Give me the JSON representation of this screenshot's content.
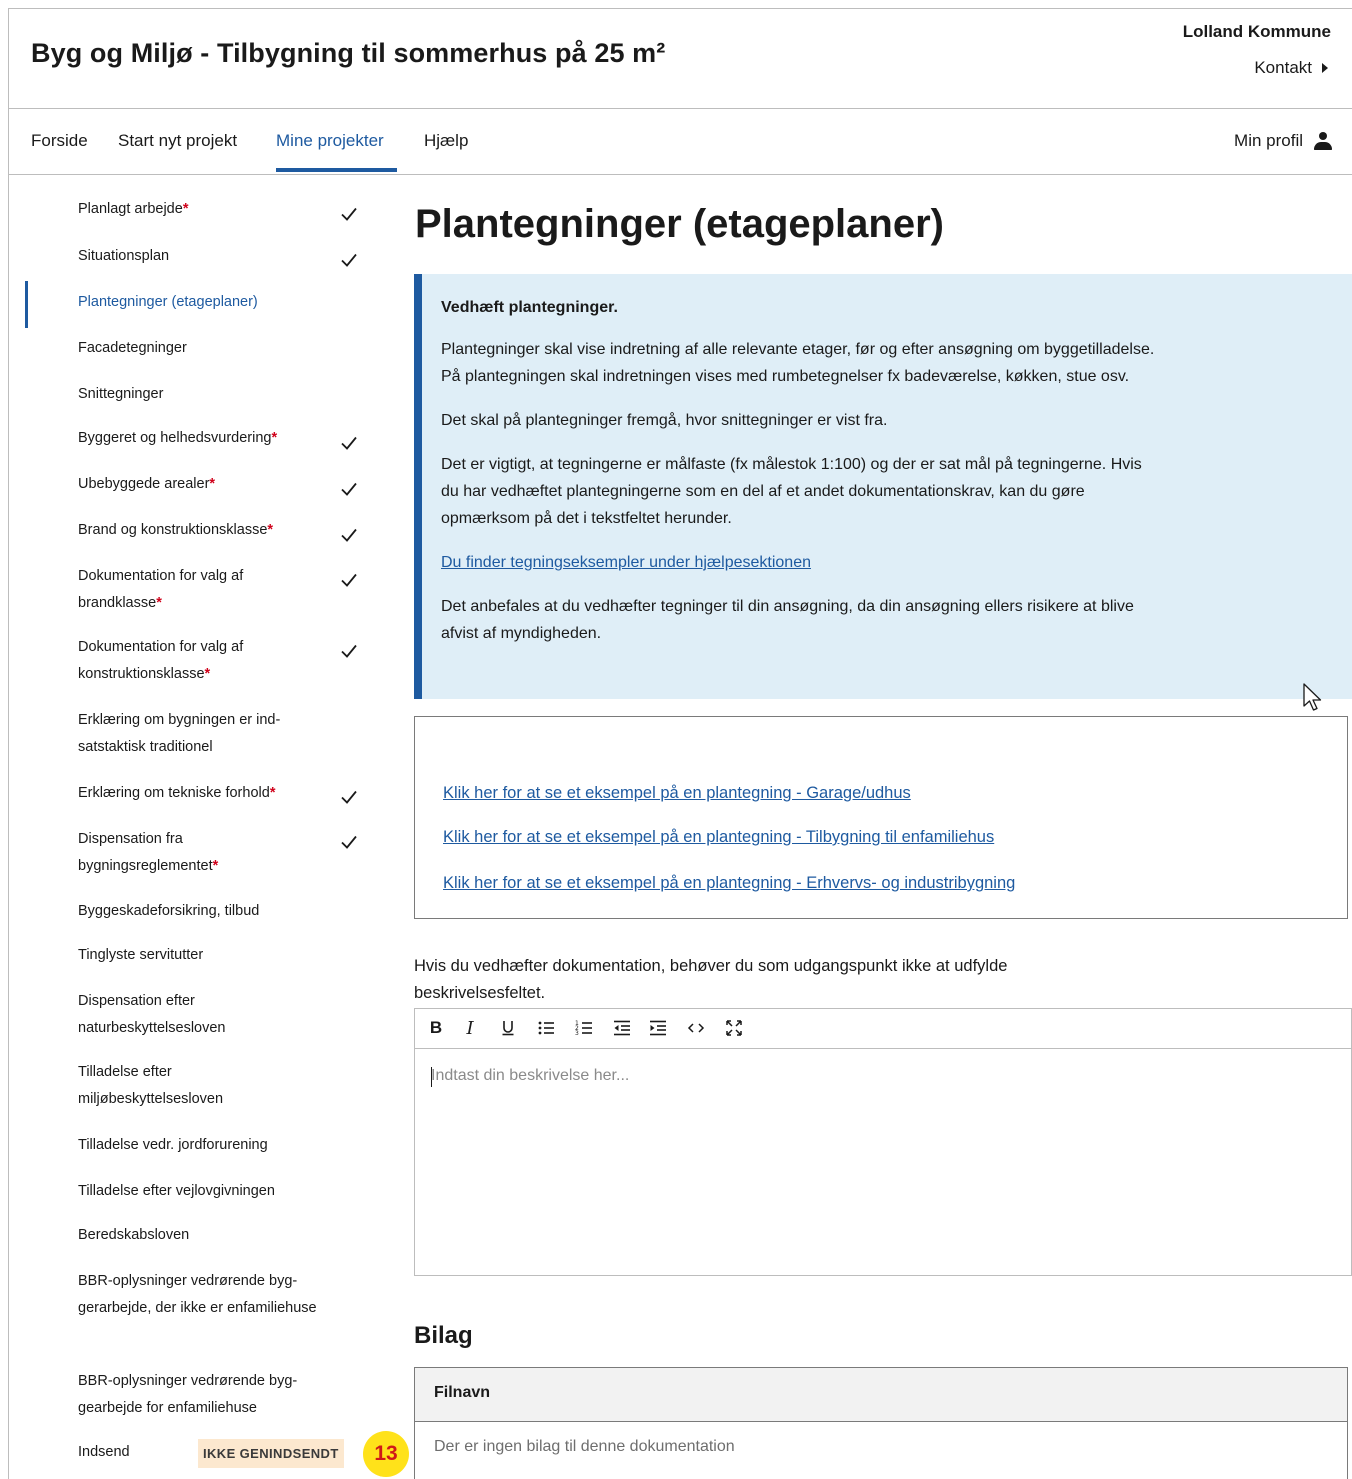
{
  "header": {
    "title": "Byg og Miljø - Tilbygning til sommerhus på 25 m²",
    "org": "Lolland Kommune",
    "contact": "Kontakt"
  },
  "nav": {
    "items": [
      "Forside",
      "Start nyt projekt",
      "Mine projekter",
      "Hjælp"
    ],
    "active": "Mine projekter",
    "profile": "Min profil"
  },
  "sidebar": {
    "items": [
      {
        "label": "Planlagt arbejde",
        "required": "*",
        "checked": true
      },
      {
        "label": "Situationsplan",
        "required": "",
        "checked": true
      },
      {
        "label": "Plantegninger (etageplaner)",
        "required": "",
        "checked": false,
        "active": true
      },
      {
        "label": "Facadetegninger",
        "required": "",
        "checked": false
      },
      {
        "label": "Snittegninger",
        "required": "",
        "checked": false
      },
      {
        "label": "Byggeret og helhedsvurdering",
        "required": "*",
        "checked": true
      },
      {
        "label": "Ubebyggede arealer",
        "required": "*",
        "checked": true
      },
      {
        "label": "Brand og konstruktionsklasse",
        "required": "*",
        "checked": true
      },
      {
        "label": "Dokumentation for valg af brandklasse",
        "required": "*",
        "checked": true
      },
      {
        "label": "Dokumentation for valg af konstruktionsklasse",
        "required": "*",
        "checked": true
      },
      {
        "label": "Erklæring om bygningen er ind-satstaktisk traditionel",
        "required": "",
        "checked": false
      },
      {
        "label": "Erklæring om tekniske forhold",
        "required": "*",
        "checked": true
      },
      {
        "label": "Dispensation fra bygningsreglementet",
        "required": "*",
        "checked": true
      },
      {
        "label": "Byggeskadeforsikring, tilbud",
        "required": "",
        "checked": false
      },
      {
        "label": "Tinglyste servitutter",
        "required": "",
        "checked": false
      },
      {
        "label": "Dispensation efter naturbeskyttelsesloven",
        "required": "",
        "checked": false
      },
      {
        "label": "Tilladelse efter miljøbeskyttelsesloven",
        "required": "",
        "checked": false
      },
      {
        "label": "Tilladelse vedr. jordforurening",
        "required": "",
        "checked": false
      },
      {
        "label": "Tilladelse efter vejlovgivningen",
        "required": "",
        "checked": false
      },
      {
        "label": "Beredskabsloven",
        "required": "",
        "checked": false
      },
      {
        "label": "BBR-oplysninger vedrørende byg-gerarbejde, der ikke er enfamiliehuse",
        "required": "",
        "checked": false
      },
      {
        "label": "BBR-oplysninger vedrørende byg-gearbejde for enfamiliehuse",
        "required": "",
        "checked": false
      },
      {
        "label": "Indsend",
        "required": "",
        "checked": false
      }
    ],
    "submit_status": "IKKE GENINDSENDT",
    "count": "13"
  },
  "main": {
    "title": "Plantegninger (etageplaner)",
    "info": {
      "lead": "Vedhæft plantegninger.",
      "p1": "Plantegninger skal vise indretning af alle relevante etager, før og efter ansøgning om byggetilladelse. På plantegningen skal indretningen vises med rumbetegnelser fx badeværelse, køkken, stue osv.",
      "p2": "Det skal på plantegninger fremgå, hvor snittegninger er vist fra.",
      "p3": "Det er vigtigt, at tegningerne er målfaste (fx målestok 1:100) og der er sat mål på tegningerne. Hvis du har vedhæftet plantegningerne som en del af et andet dokumentationskrav, kan du gøre opmærksom på det i tekstfeltet herunder.",
      "link": "Du finder tegningseksempler under hjælpesektionen",
      "p4": "Det anbefales at du vedhæfter tegninger til din ansøgning, da din ansøgning ellers risikere at blive afvist af myndigheden."
    },
    "example_links": [
      "Klik her for at se et eksempel på en plantegning - Garage/udhus",
      "Klik her for at se et eksempel på en plantegning - Tilbygning til enfamiliehus",
      "Klik her for at se et eksempel på en plantegning - Erhvervs- og industribygning"
    ],
    "description_label": "Hvis du vedhæfter dokumentation, behøver du som udgangspunkt ikke at udfylde beskrivelsesfeltet.",
    "editor": {
      "placeholder": "Indtast din beskrivelse her...",
      "tools": [
        "bold-icon",
        "italic-icon",
        "underline-icon",
        "bullet-list-icon",
        "numbered-list-icon",
        "outdent-icon",
        "indent-icon",
        "code-icon",
        "fullscreen-icon"
      ]
    },
    "attachments": {
      "title": "Bilag",
      "column": "Filnavn",
      "empty": "Der er ingen bilag til denne dokumentation"
    }
  }
}
